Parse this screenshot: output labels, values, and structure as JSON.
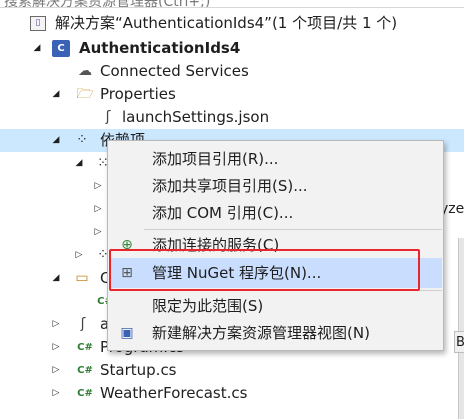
{
  "search": {
    "text": "搜索解决方案资源管理器(Ctrl+;)"
  },
  "tree": {
    "solution_label": "解决方案“AuthenticationIds4”(1 个项目/共 1 个)",
    "project_label": "AuthenticationIds4",
    "connected_services": "Connected Services",
    "properties": "Properties",
    "launch_settings": "launchSettings.json",
    "dependencies": "依赖项",
    "a_partial": "a",
    "c_partial": "C",
    "cs_badge": "C#",
    "program": "Program.cs",
    "startup": "Startup.cs",
    "weather": "WeatherForecast.cs"
  },
  "context_menu": {
    "items": [
      {
        "label": "添加项目引用(R)..."
      },
      {
        "label": "添加共享项目引用(S)..."
      },
      {
        "label": "添加 COM 引用(C)..."
      },
      {
        "label": "添加连接的服务(C)"
      },
      {
        "label": "管理 NuGet 程序包(N)..."
      },
      {
        "label": "限定为此范围(S)"
      },
      {
        "label": "新建解决方案资源管理器视图(N)"
      }
    ]
  },
  "fragments": {
    "right_edge": "yze",
    "b_button": "B"
  },
  "colors": {
    "selection": "#cce8ff",
    "menu_highlight": "#c9deff",
    "callout": "#e8262b"
  }
}
